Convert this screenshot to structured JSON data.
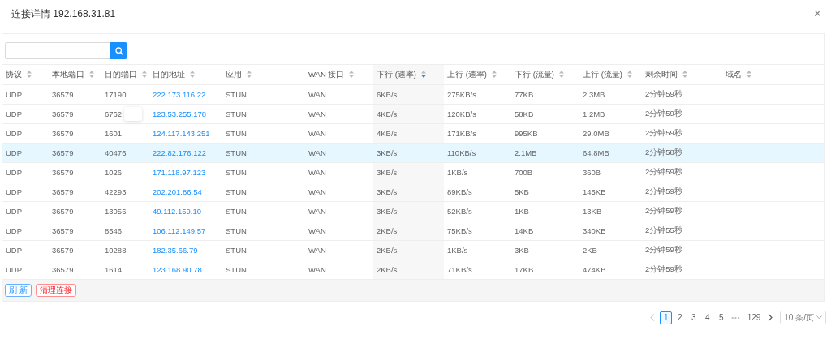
{
  "window": {
    "title": "连接详情 192.168.31.81",
    "close": "×"
  },
  "table": {
    "columns": [
      {
        "label": "协议",
        "sorted": false
      },
      {
        "label": "本地端口",
        "sorted": false
      },
      {
        "label": "目的端口",
        "sorted": false
      },
      {
        "label": "目的地址",
        "sorted": false
      },
      {
        "label": "应用",
        "sorted": false
      },
      {
        "label": "WAN 接口",
        "sorted": false
      },
      {
        "label": "下行 (速率)",
        "sorted": true
      },
      {
        "label": "上行 (速率)",
        "sorted": false
      },
      {
        "label": "下行 (流量)",
        "sorted": false
      },
      {
        "label": "上行 (流量)",
        "sorted": false
      },
      {
        "label": "剩余时间",
        "sorted": false
      },
      {
        "label": "域名",
        "sorted": false
      }
    ],
    "rows": [
      {
        "selected": false,
        "tooltip": false,
        "cells": [
          "UDP",
          "36579",
          "17190",
          "222.173.116.22",
          "STUN",
          "WAN",
          "6KB/s",
          "275KB/s",
          "77KB",
          "2.3MB",
          "2分钟59秒"
        ]
      },
      {
        "selected": false,
        "tooltip": true,
        "cells": [
          "UDP",
          "36579",
          "6762",
          "123.53.255.178",
          "STUN",
          "WAN",
          "4KB/s",
          "120KB/s",
          "58KB",
          "1.2MB",
          "2分钟59秒"
        ]
      },
      {
        "selected": false,
        "tooltip": false,
        "cells": [
          "UDP",
          "36579",
          "1601",
          "124.117.143.251",
          "STUN",
          "WAN",
          "4KB/s",
          "171KB/s",
          "995KB",
          "29.0MB",
          "2分钟59秒"
        ]
      },
      {
        "selected": true,
        "tooltip": false,
        "cells": [
          "UDP",
          "36579",
          "40476",
          "222.82.176.122",
          "STUN",
          "WAN",
          "3KB/s",
          "110KB/s",
          "2.1MB",
          "64.8MB",
          "2分钟58秒"
        ]
      },
      {
        "selected": false,
        "tooltip": false,
        "cells": [
          "UDP",
          "36579",
          "1026",
          "171.118.97.123",
          "STUN",
          "WAN",
          "3KB/s",
          "1KB/s",
          "700B",
          "360B",
          "2分钟59秒"
        ]
      },
      {
        "selected": false,
        "tooltip": false,
        "cells": [
          "UDP",
          "36579",
          "42293",
          "202.201.86.54",
          "STUN",
          "WAN",
          "3KB/s",
          "89KB/s",
          "5KB",
          "145KB",
          "2分钟59秒"
        ]
      },
      {
        "selected": false,
        "tooltip": false,
        "cells": [
          "UDP",
          "36579",
          "13056",
          "49.112.159.10",
          "STUN",
          "WAN",
          "3KB/s",
          "52KB/s",
          "1KB",
          "13KB",
          "2分钟59秒"
        ]
      },
      {
        "selected": false,
        "tooltip": false,
        "cells": [
          "UDP",
          "36579",
          "8546",
          "106.112.149.57",
          "STUN",
          "WAN",
          "2KB/s",
          "75KB/s",
          "14KB",
          "340KB",
          "2分钟55秒"
        ]
      },
      {
        "selected": false,
        "tooltip": false,
        "cells": [
          "UDP",
          "36579",
          "10288",
          "182.35.66.79",
          "STUN",
          "WAN",
          "2KB/s",
          "1KB/s",
          "3KB",
          "2KB",
          "2分钟59秒"
        ]
      },
      {
        "selected": false,
        "tooltip": false,
        "cells": [
          "UDP",
          "36579",
          "1614",
          "123.168.90.78",
          "STUN",
          "WAN",
          "2KB/s",
          "71KB/s",
          "17KB",
          "474KB",
          "2分钟59秒"
        ]
      }
    ]
  },
  "actions": [
    {
      "label": "刷 新",
      "kind": "primary"
    },
    {
      "label": "清理连接",
      "kind": "danger"
    }
  ],
  "pagination": {
    "prev_disabled": true,
    "next_disabled": false,
    "pages": [
      {
        "label": "1",
        "kind": "page",
        "selected": true
      },
      {
        "label": "2",
        "kind": "page",
        "selected": false
      },
      {
        "label": "3",
        "kind": "page",
        "selected": false
      },
      {
        "label": "4",
        "kind": "page",
        "selected": false
      },
      {
        "label": "5",
        "kind": "page",
        "selected": false
      },
      {
        "label": "•••",
        "kind": "ellipsis",
        "selected": false
      },
      {
        "label": "129",
        "kind": "page",
        "selected": false
      }
    ],
    "page_size": "10 条/页"
  }
}
